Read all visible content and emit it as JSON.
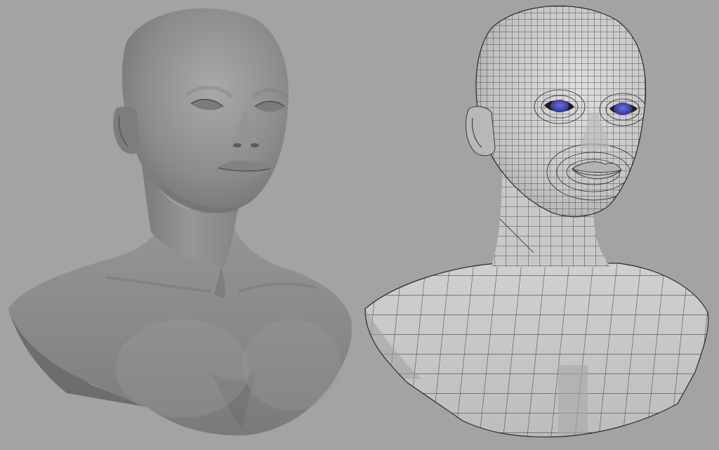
{
  "viewport": {
    "background": "#a3a3a3",
    "models": [
      {
        "name": "sculpt-bust",
        "material": "clay-smooth-shaded",
        "surface_color": "#8f8f8f"
      },
      {
        "name": "wireframe-bust",
        "material": "quad-topology-wireframe",
        "surface_color": "#c9c9c9",
        "wire_color": "#2a2a2a",
        "eye_color": "#3b3fa8"
      }
    ]
  }
}
